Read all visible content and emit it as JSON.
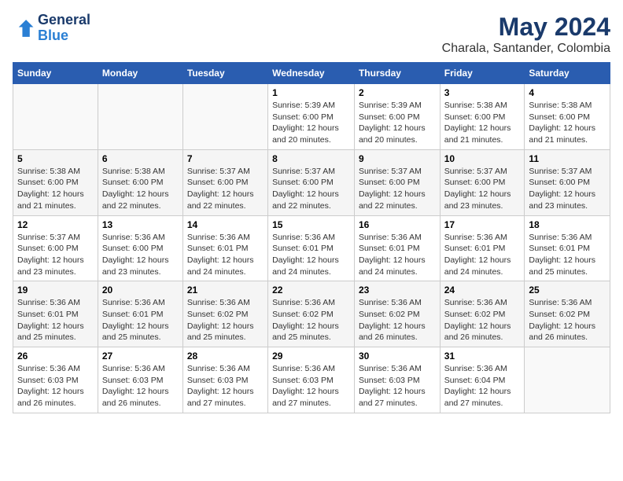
{
  "header": {
    "logo_line1": "General",
    "logo_line2": "Blue",
    "title": "May 2024",
    "subtitle": "Charala, Santander, Colombia"
  },
  "weekdays": [
    "Sunday",
    "Monday",
    "Tuesday",
    "Wednesday",
    "Thursday",
    "Friday",
    "Saturday"
  ],
  "weeks": [
    [
      {
        "day": "",
        "info": ""
      },
      {
        "day": "",
        "info": ""
      },
      {
        "day": "",
        "info": ""
      },
      {
        "day": "1",
        "info": "Sunrise: 5:39 AM\nSunset: 6:00 PM\nDaylight: 12 hours and 20 minutes."
      },
      {
        "day": "2",
        "info": "Sunrise: 5:39 AM\nSunset: 6:00 PM\nDaylight: 12 hours and 20 minutes."
      },
      {
        "day": "3",
        "info": "Sunrise: 5:38 AM\nSunset: 6:00 PM\nDaylight: 12 hours and 21 minutes."
      },
      {
        "day": "4",
        "info": "Sunrise: 5:38 AM\nSunset: 6:00 PM\nDaylight: 12 hours and 21 minutes."
      }
    ],
    [
      {
        "day": "5",
        "info": "Sunrise: 5:38 AM\nSunset: 6:00 PM\nDaylight: 12 hours and 21 minutes."
      },
      {
        "day": "6",
        "info": "Sunrise: 5:38 AM\nSunset: 6:00 PM\nDaylight: 12 hours and 22 minutes."
      },
      {
        "day": "7",
        "info": "Sunrise: 5:37 AM\nSunset: 6:00 PM\nDaylight: 12 hours and 22 minutes."
      },
      {
        "day": "8",
        "info": "Sunrise: 5:37 AM\nSunset: 6:00 PM\nDaylight: 12 hours and 22 minutes."
      },
      {
        "day": "9",
        "info": "Sunrise: 5:37 AM\nSunset: 6:00 PM\nDaylight: 12 hours and 22 minutes."
      },
      {
        "day": "10",
        "info": "Sunrise: 5:37 AM\nSunset: 6:00 PM\nDaylight: 12 hours and 23 minutes."
      },
      {
        "day": "11",
        "info": "Sunrise: 5:37 AM\nSunset: 6:00 PM\nDaylight: 12 hours and 23 minutes."
      }
    ],
    [
      {
        "day": "12",
        "info": "Sunrise: 5:37 AM\nSunset: 6:00 PM\nDaylight: 12 hours and 23 minutes."
      },
      {
        "day": "13",
        "info": "Sunrise: 5:36 AM\nSunset: 6:00 PM\nDaylight: 12 hours and 23 minutes."
      },
      {
        "day": "14",
        "info": "Sunrise: 5:36 AM\nSunset: 6:01 PM\nDaylight: 12 hours and 24 minutes."
      },
      {
        "day": "15",
        "info": "Sunrise: 5:36 AM\nSunset: 6:01 PM\nDaylight: 12 hours and 24 minutes."
      },
      {
        "day": "16",
        "info": "Sunrise: 5:36 AM\nSunset: 6:01 PM\nDaylight: 12 hours and 24 minutes."
      },
      {
        "day": "17",
        "info": "Sunrise: 5:36 AM\nSunset: 6:01 PM\nDaylight: 12 hours and 24 minutes."
      },
      {
        "day": "18",
        "info": "Sunrise: 5:36 AM\nSunset: 6:01 PM\nDaylight: 12 hours and 25 minutes."
      }
    ],
    [
      {
        "day": "19",
        "info": "Sunrise: 5:36 AM\nSunset: 6:01 PM\nDaylight: 12 hours and 25 minutes."
      },
      {
        "day": "20",
        "info": "Sunrise: 5:36 AM\nSunset: 6:01 PM\nDaylight: 12 hours and 25 minutes."
      },
      {
        "day": "21",
        "info": "Sunrise: 5:36 AM\nSunset: 6:02 PM\nDaylight: 12 hours and 25 minutes."
      },
      {
        "day": "22",
        "info": "Sunrise: 5:36 AM\nSunset: 6:02 PM\nDaylight: 12 hours and 25 minutes."
      },
      {
        "day": "23",
        "info": "Sunrise: 5:36 AM\nSunset: 6:02 PM\nDaylight: 12 hours and 26 minutes."
      },
      {
        "day": "24",
        "info": "Sunrise: 5:36 AM\nSunset: 6:02 PM\nDaylight: 12 hours and 26 minutes."
      },
      {
        "day": "25",
        "info": "Sunrise: 5:36 AM\nSunset: 6:02 PM\nDaylight: 12 hours and 26 minutes."
      }
    ],
    [
      {
        "day": "26",
        "info": "Sunrise: 5:36 AM\nSunset: 6:03 PM\nDaylight: 12 hours and 26 minutes."
      },
      {
        "day": "27",
        "info": "Sunrise: 5:36 AM\nSunset: 6:03 PM\nDaylight: 12 hours and 26 minutes."
      },
      {
        "day": "28",
        "info": "Sunrise: 5:36 AM\nSunset: 6:03 PM\nDaylight: 12 hours and 27 minutes."
      },
      {
        "day": "29",
        "info": "Sunrise: 5:36 AM\nSunset: 6:03 PM\nDaylight: 12 hours and 27 minutes."
      },
      {
        "day": "30",
        "info": "Sunrise: 5:36 AM\nSunset: 6:03 PM\nDaylight: 12 hours and 27 minutes."
      },
      {
        "day": "31",
        "info": "Sunrise: 5:36 AM\nSunset: 6:04 PM\nDaylight: 12 hours and 27 minutes."
      },
      {
        "day": "",
        "info": ""
      }
    ]
  ]
}
